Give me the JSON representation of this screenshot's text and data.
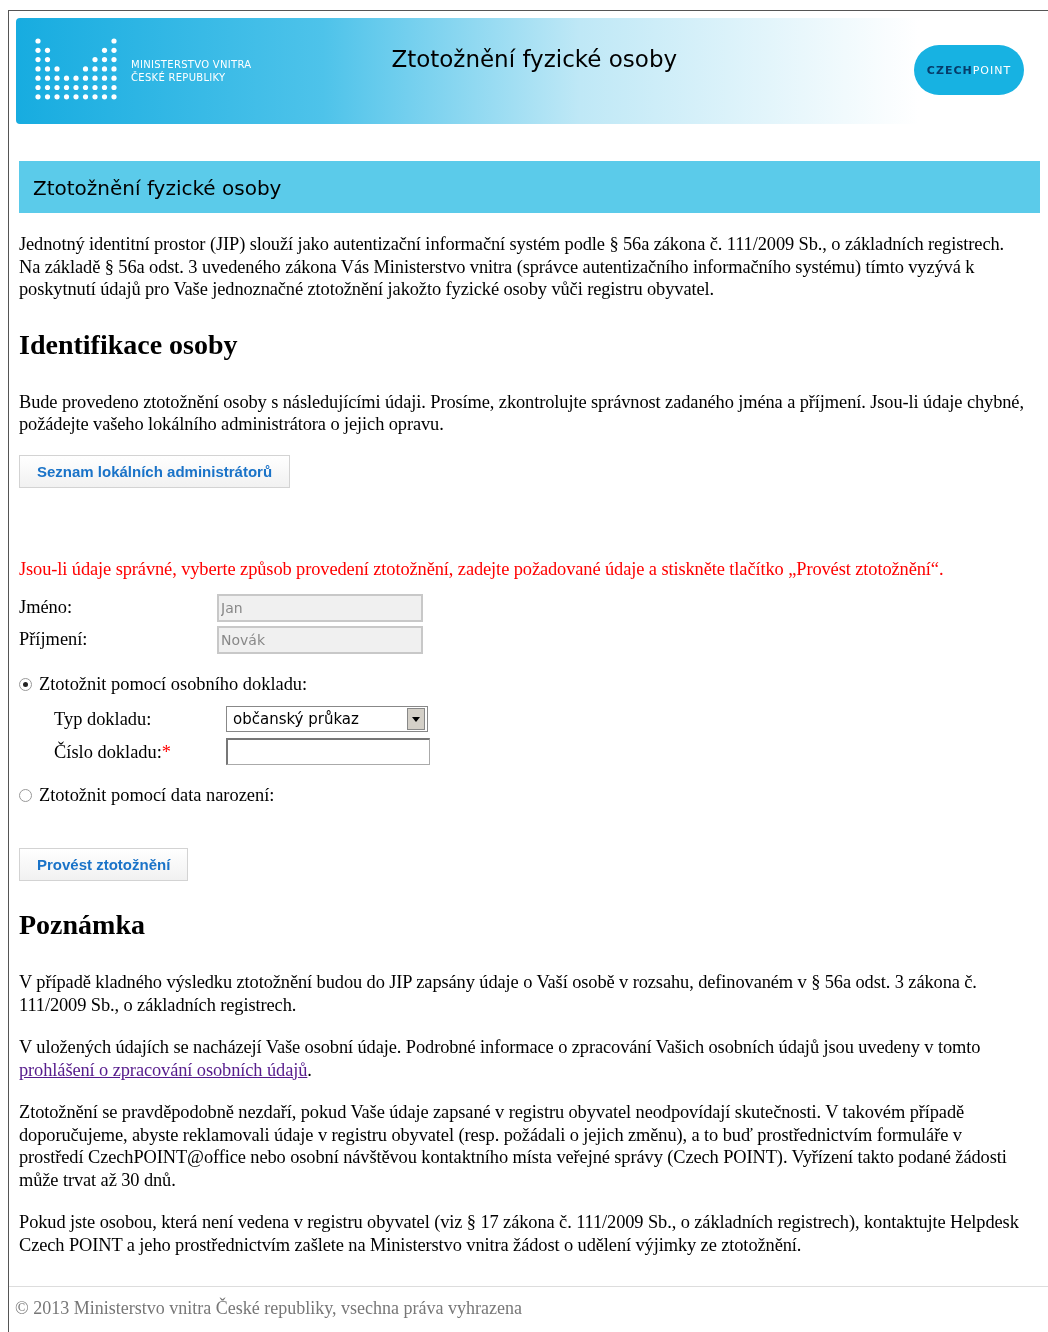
{
  "header": {
    "ministry_lines": [
      "MINISTERSTVO VNITRA",
      "ČESKÉ REPUBLIKY"
    ],
    "title": "Ztotožnění fyzické osoby",
    "logo_parts": [
      "CZECH",
      "POINT"
    ]
  },
  "page_title": "Ztotožnění fyzické osoby",
  "intro": "Jednotný identitní prostor (JIP) slouží jako autentizační informační systém podle § 56a zákona č. 111/2009 Sb., o základních registrech. Na základě § 56a odst. 3 uvedeného zákona Vás Ministerstvo vnitra (správce autentizačního informačního systému) tímto vyzývá k poskytnutí údajů pro Vaše jednoznačné ztotožnění jakožto fyzické osoby vůči registru obyvatel.",
  "identification": {
    "heading": "Identifikace osoby",
    "text": "Bude provedeno ztotožnění osoby s následujícími údaji. Prosíme, zkontrolujte správnost zadaného jména a příjmení. Jsou-li údaje chybné, požádejte vašeho lokálního administrátora o jejich opravu.",
    "admin_button": "Seznam lokálních administrátorů"
  },
  "instruction": "Jsou-li údaje správné, vyberte způsob provedení ztotožnění, zadejte požadované údaje a stiskněte tlačítko „Provést ztotožnění“.",
  "fields": [
    {
      "label": "Jméno:",
      "value": "Jan",
      "disabled": true
    },
    {
      "label": "Příjmení:",
      "value": "Novák",
      "disabled": true
    }
  ],
  "methods": [
    {
      "label": "Ztotožnit pomocí osobního dokladu:",
      "selected": true,
      "subfields": [
        {
          "kind": "select",
          "label": "Typ dokladu:",
          "value": "občanský průkaz"
        },
        {
          "kind": "text",
          "label": "Číslo dokladu:",
          "required_mark": "*"
        }
      ]
    },
    {
      "label": "Ztotožnit pomocí data narození:",
      "selected": false
    }
  ],
  "submit_button": "Provést ztotožnění",
  "note": {
    "heading": "Poznámka",
    "paragraphs": [
      "V případě kladného výsledku ztotožnění budou do JIP zapsány údaje o Vaší osobě v rozsahu, definovaném v § 56a odst. 3 zákona č. 111/2009 Sb., o základních registrech.",
      {
        "text": "V uložených údajích se nacházejí Vaše osobní údaje. Podrobné informace o zpracování Vašich osobních údajů jsou uvedeny v tomto ",
        "link": "prohlášení o zpracování osobních údajů",
        "text_after": "."
      },
      "Ztotožnění se pravděpodobně nezdaří, pokud Vaše údaje zapsané v registru obyvatel neodpovídají skutečnosti. V takovém případě doporučujeme, abyste reklamovali údaje v registru obyvatel (resp. požádali o jejich změnu), a to buď prostřednictvím formuláře v prostředí CzechPOINT@office nebo osobní návštěvou kontaktního místa veřejné správy (Czech POINT). Vyřízení takto podané žádosti může trvat až 30 dnů.",
      "Pokud jste osobou, která není vedena v registru obyvatel (viz § 17 zákona č. 111/2009 Sb., o základních registrech), kontaktujte Helpdesk Czech POINT a jeho prostřednictvím zašlete na Ministerstvo vnitra žádost o udělení výjimky ze ztotožnění."
    ]
  },
  "footer": "© 2013 Ministerstvo vnitra České republiky, vsechna práva vyhrazena"
}
